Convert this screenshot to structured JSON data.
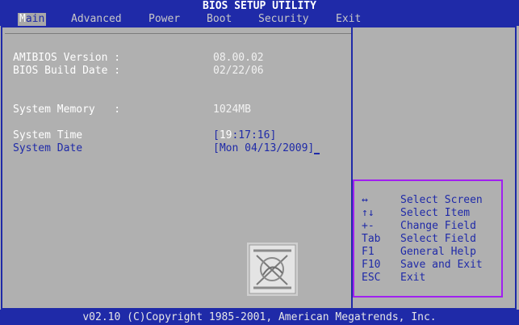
{
  "header": {
    "title": "BIOS SETUP UTILITY",
    "menu": [
      {
        "label": "Main",
        "first": "M",
        "rest": "ain",
        "active": true
      },
      {
        "label": "Advanced"
      },
      {
        "label": "Power"
      },
      {
        "label": "Boot"
      },
      {
        "label": "Security"
      },
      {
        "label": "Exit"
      }
    ]
  },
  "main": {
    "info": [
      {
        "label": "AMIBIOS Version :",
        "value": "08.00.02"
      },
      {
        "label": "BIOS Build Date :",
        "value": "02/22/06"
      },
      {
        "label": "System Memory   :",
        "value": "1024MB"
      }
    ],
    "system_time": {
      "label": "System Time",
      "bracket": "[",
      "selected": "19",
      "rest": ":17:16]"
    },
    "system_date": {
      "label": "System Date",
      "value": "[Mon 04/13/2009]"
    }
  },
  "help": [
    {
      "key": "↔",
      "desc": "Select Screen"
    },
    {
      "key": "↑↓",
      "desc": "Select Item"
    },
    {
      "key": "+-",
      "desc": "Change Field"
    },
    {
      "key": "Tab",
      "desc": "Select Field"
    },
    {
      "key": "F1",
      "desc": "General Help"
    },
    {
      "key": "F10",
      "desc": "Save and Exit"
    },
    {
      "key": "ESC",
      "desc": "Exit"
    }
  ],
  "footer": {
    "text": "v02.10 (C)Copyright 1985-2001, American Megatrends, Inc."
  },
  "colors": {
    "blue": "#1f2aa8",
    "panel": "#b0b0b0",
    "highlight": "#a020f0"
  }
}
